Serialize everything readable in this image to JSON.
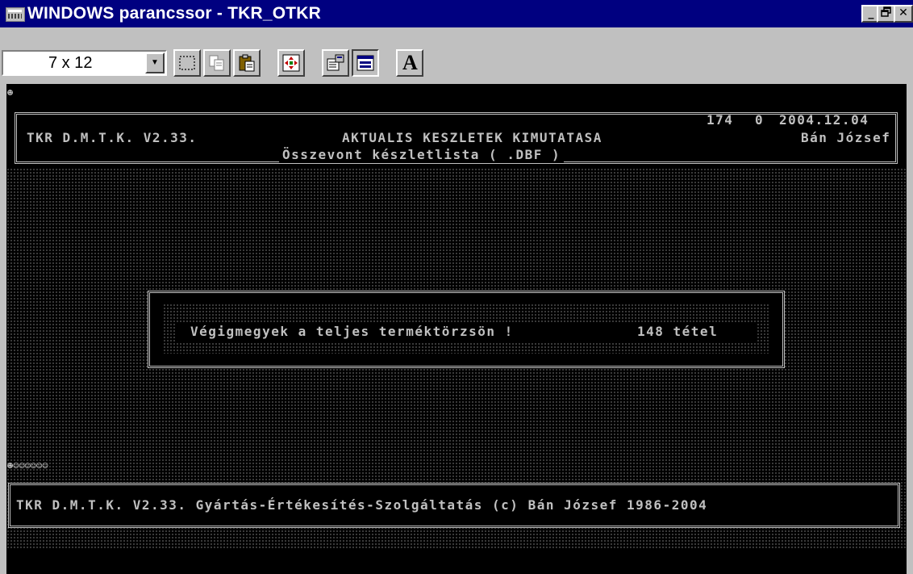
{
  "window": {
    "title": "WINDOWS parancssor - TKR_OTKR",
    "minimize": "_",
    "maximize": "▫",
    "close": "✕"
  },
  "toolbar": {
    "font_size": "7 x 12",
    "tools": [
      "mark",
      "copy",
      "paste",
      "full-screen",
      "properties",
      "background",
      "font"
    ],
    "font_button_label": "A"
  },
  "console": {
    "header": {
      "app_name": "TKR D.M.T.K. V2.33.",
      "report_title": "AKTUALIS KESZLETEK KIMUTATASA",
      "subtitle": "Összevont készletlista ( .DBF )",
      "counter": "174",
      "flag": "0",
      "date": "2004.12.04",
      "user": "Bán József"
    },
    "dialog": {
      "message": "Végigmegyek a teljes terméktörzsön !",
      "count_text": "148 tétel"
    },
    "footer": {
      "copyright": "TKR D.M.T.K. V2.33. Gyártás-Értékesítés-Szolgáltatás (c) Bán József 1986-2004"
    },
    "status_smileys": "☻☺☺☺☺☺☺"
  },
  "colors": {
    "titlebar": "#000080",
    "console_bg": "#000000",
    "console_fg": "#c0c0c0",
    "chrome": "#c0c0c0"
  }
}
